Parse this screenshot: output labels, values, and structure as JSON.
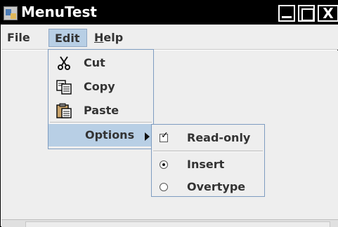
{
  "window": {
    "title": "MenuTest",
    "close_glyph": "X"
  },
  "menubar": {
    "items": [
      {
        "label": "File"
      },
      {
        "label": "Edit"
      },
      {
        "mnemonic": "H",
        "rest": "elp"
      }
    ]
  },
  "edit_menu": {
    "items": [
      {
        "label": "Cut",
        "icon": "scissors-icon"
      },
      {
        "label": "Copy",
        "icon": "copy-icon"
      },
      {
        "label": "Paste",
        "icon": "paste-icon"
      },
      {
        "label": "Options",
        "icon": "submenu-arrow-icon"
      }
    ]
  },
  "options_menu": {
    "items": [
      {
        "label": "Read-only",
        "type": "checkbox",
        "checked": true
      },
      {
        "label": "Insert",
        "type": "radio",
        "selected": true
      },
      {
        "label": "Overtype",
        "type": "radio",
        "selected": false
      }
    ]
  },
  "colors": {
    "titlebar": "#000000",
    "menubar": "#eeeeee",
    "selection": "#b8cfe5",
    "menu_border": "#7e9cc0",
    "text": "#333333"
  }
}
